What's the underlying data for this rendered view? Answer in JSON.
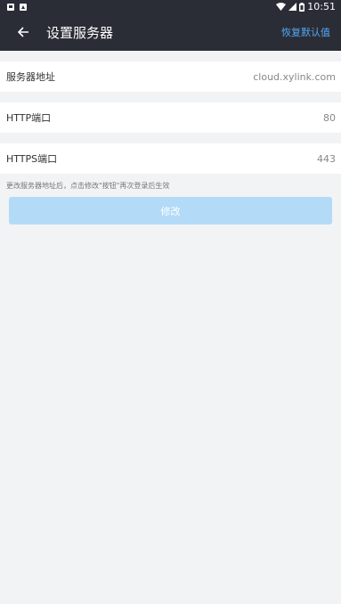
{
  "status_bar": {
    "time": "10:51",
    "icons": [
      "notification-icon",
      "app-icon",
      "wifi-icon",
      "signal-icon",
      "battery-icon"
    ]
  },
  "app_bar": {
    "title": "设置服务器",
    "restore_label": "恢复默认值"
  },
  "settings": {
    "server": {
      "label": "服务器地址",
      "value": "cloud.xylink.com"
    },
    "http_port": {
      "label": "HTTP端口",
      "value": "80"
    },
    "https_port": {
      "label": "HTTPS端口",
      "value": "443"
    }
  },
  "hint": "更改服务器地址后，点击修改\"按钮\"再次登录后生效",
  "button": {
    "label": "修改"
  },
  "colors": {
    "header_bg": "#2b2d36",
    "accent": "#52a8f5",
    "button_disabled": "#b3dbf8",
    "page_bg": "#f2f3f5"
  }
}
